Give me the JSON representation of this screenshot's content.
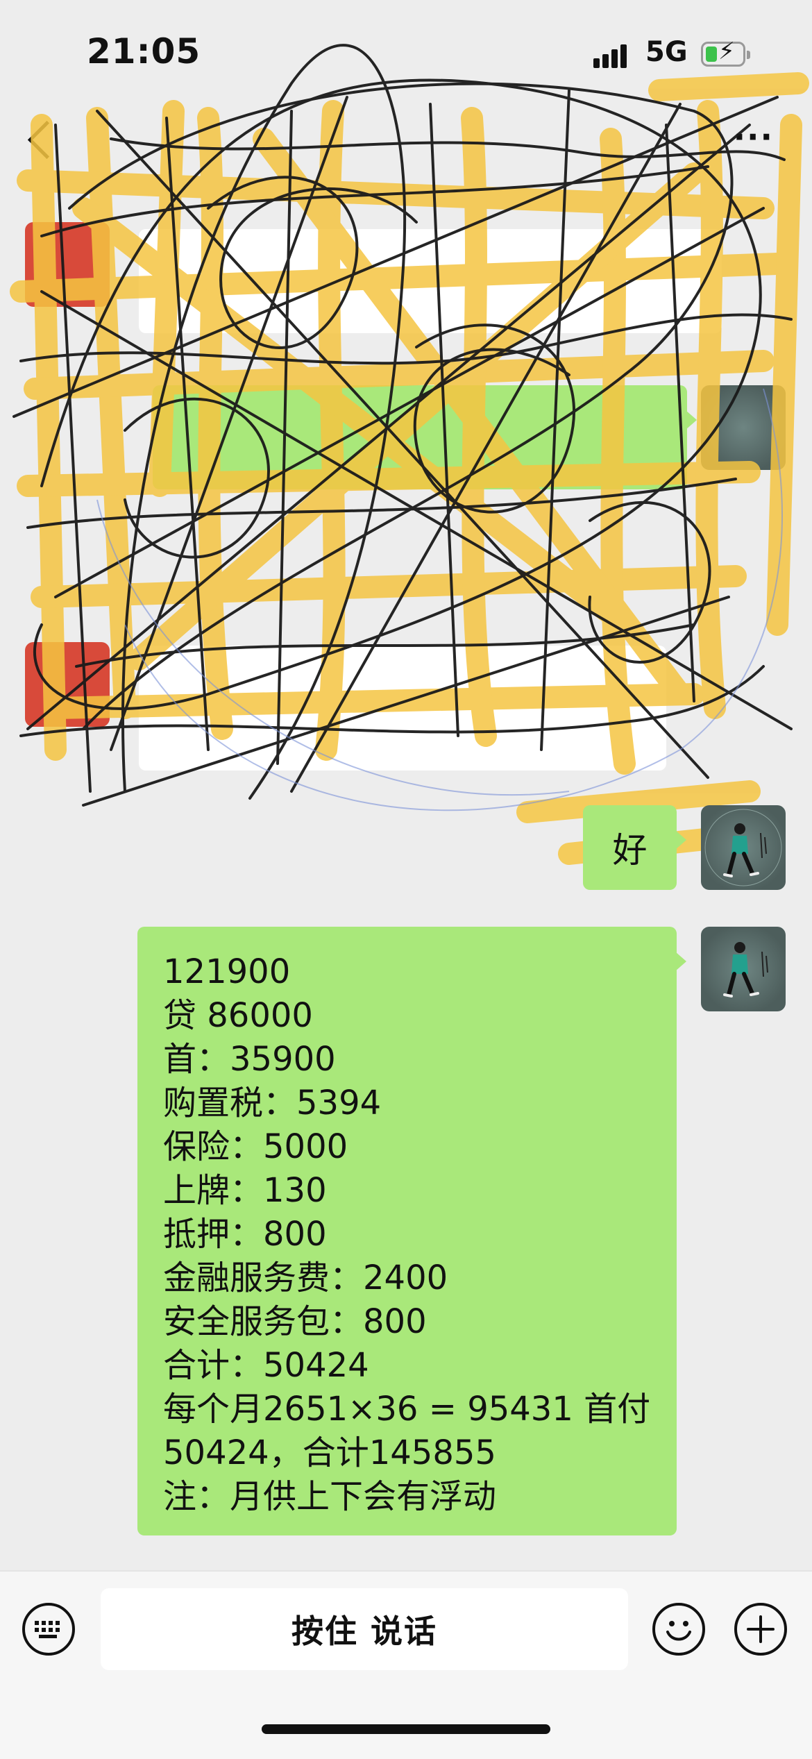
{
  "status_bar": {
    "time": "21:05",
    "network": "5G",
    "battery_level": 0.25
  },
  "nav": {
    "title": "",
    "more_glyph": "···"
  },
  "messages": {
    "reply": "好",
    "quote_lines": [
      "121900",
      "贷 86000",
      "首：35900",
      "购置税：5394",
      "保险：5000",
      "上牌：130",
      "抵押：800",
      "金融服务费：2400",
      "安全服务包：800",
      "合计：50424",
      "每个月2651×36 = 95431  首付",
      "50424，合计145855",
      "注：月供上下会有浮动"
    ]
  },
  "input_bar": {
    "talk_label": "按住 说话"
  },
  "icons": {
    "back": "chevron-left-icon",
    "more": "more-icon",
    "keyboard": "keyboard-icon",
    "emoji": "emoji-icon",
    "plus": "plus-icon"
  },
  "colors": {
    "bubble_green": "#a9e87a",
    "background": "#ededed",
    "redaction_yellow": "#f5c542"
  }
}
